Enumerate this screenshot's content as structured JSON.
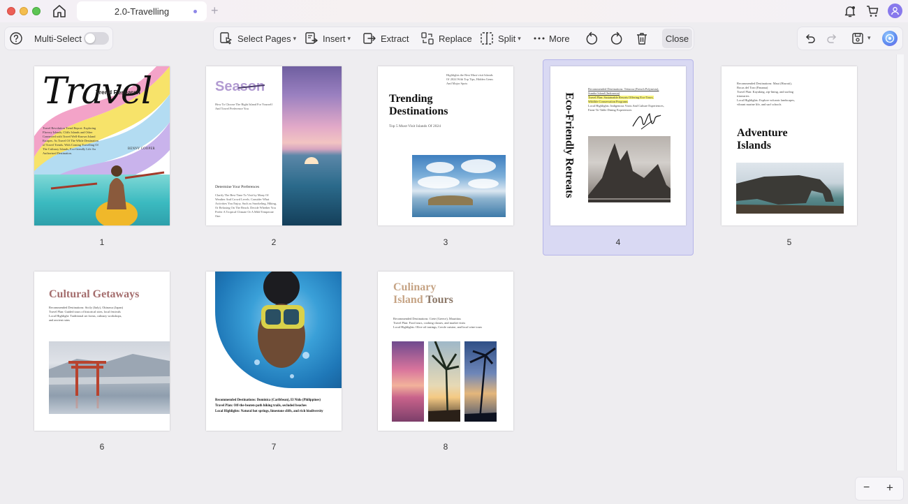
{
  "titlebar": {
    "tab_title": "2.0-Travelling",
    "tab_add": "+"
  },
  "toolbar": {
    "multi_select_label": "Multi-Select",
    "select_pages": "Select Pages",
    "insert": "Insert",
    "extract": "Extract",
    "replace": "Replace",
    "split": "Split",
    "more": "More",
    "close": "Close"
  },
  "pages": {
    "p1": {
      "num": "1",
      "title": "Travel",
      "subtitle": "Trend Research",
      "author": "BENNY COOPER",
      "body": "Travel Revolution Trend Report: Exploring Flavory Islands, Cliffs Islands and Other Connected with Travel Well-Known Island Escapes. As Travel Of The While Destination of Travel Trends. With Coming Travelling Of The Culinary Islands, Eco-friendly Life An Authorised Destination."
    },
    "p2": {
      "num": "2",
      "title": "Season",
      "intro": "How To Choose The Right Island For Yourself And Travel Preference You",
      "heading": "Determine Your Preferences",
      "body": "Clarify The Best Time To Visit by Many Of Weather And Crowd Levels. Consider What Activities You Enjoy, Such as Snorkeling, Hiking, Or Relaxing On The Beach. Decide Whether You Prefer A Tropical Climate Or A Mild Temperate One."
    },
    "p3": {
      "num": "3",
      "note": "Highlights the Best Must-visit Islands Of 2024 With Top Tips, Hidden Gems And Major Spots",
      "title_1": "Trending",
      "title_2": "Destinations",
      "subtitle": "Top 5 Must-Visit Islands Of 2024"
    },
    "p4": {
      "num": "4",
      "vertical_title": "Eco-Friendly Retreats",
      "line1": "Recommended Destinations: Tetiaroa (French Polynesia),",
      "line2": "Sumba Island (Indonesia)",
      "line3": "Travel Plan: Sustainable Resorts Offering Eco-Tours,",
      "line4": "Wildlife Conservation Programs",
      "line5": "Local Highlights: Indigenous Visits And Culture Experiences,",
      "line6": "Farm-To-Table Dining Experiences"
    },
    "p5": {
      "num": "5",
      "line1": "Recommended Destinations: Maui (Hawaii),",
      "line2": "Bocas del Toro (Panama)",
      "line3": "Travel Plan: Kayaking, zip-lining, and surfing",
      "line4": "itineraries",
      "line5": "Local Highlights: Explore volcanic landscapes,",
      "line6": "vibrant marine life, and surf schools",
      "title_1": "Adventure",
      "title_2": "Islands"
    },
    "p6": {
      "num": "6",
      "title": "Cultural Getaways",
      "line1": "Recommended Destinations: Sicily (Italy), Okinawa (Japan)",
      "line2": "Travel Plan: Guided tours of historical sites, local festivals",
      "line3": "Local Highlight: Traditional art forms, culinary workshops,",
      "line4": "and ancient ruins"
    },
    "p7": {
      "num": "7",
      "line1": "Recommended Destinations: Dominica (Caribbean), El Nido (Philippines)",
      "line2": "Travel Plan: Off-the-beaten-path hiking trails, secluded beaches",
      "line3": "Local Highlights: Natural hot springs, limestone cliffs, and rich biodiversity"
    },
    "p8": {
      "num": "8",
      "title_1": "Culinary",
      "title_2a": "Island",
      "title_2b": "Tours",
      "line1": "Recommended Destinations: Crete (Greece), Mauritius",
      "line2": "Travel Plan: Food tours, cooking classes, and market visits",
      "line3": "Local Highlights: Olive oil tastings, Creole cuisine, and local wine tours"
    }
  },
  "zoom": {
    "minus": "−",
    "plus": "+"
  },
  "colors": {
    "accent": "#8879ec",
    "selection_bg": "#d9d9f3",
    "selection_border": "#b6b5e9"
  }
}
